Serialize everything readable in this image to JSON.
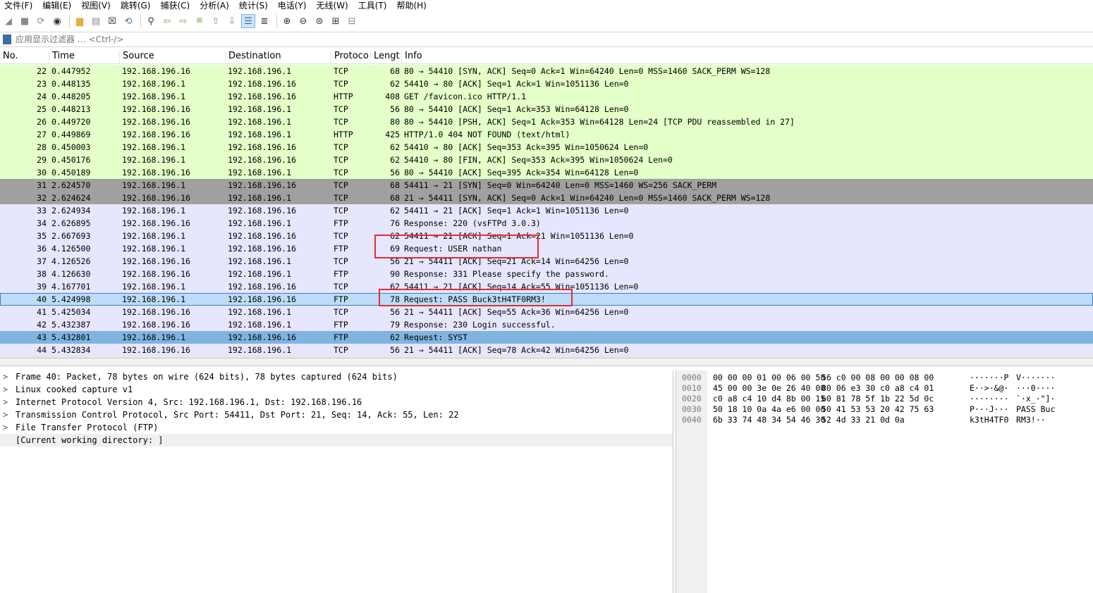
{
  "menubar": {
    "items": [
      "文件(F)",
      "编辑(E)",
      "视图(V)",
      "跳转(G)",
      "捕获(C)",
      "分析(A)",
      "统计(S)",
      "电话(Y)",
      "无线(W)",
      "工具(T)",
      "帮助(H)"
    ]
  },
  "toolbar": {
    "icons": [
      "shark-fin-start-icon",
      "stop-icon",
      "restart-icon",
      "capture-options-icon",
      "open-folder-icon",
      "save-icon",
      "close-file-icon",
      "reload-icon",
      "find-packet-icon",
      "go-back-icon",
      "go-forward-icon",
      "go-to-packet-icon",
      "go-first-icon",
      "go-last-icon",
      "autoscroll-icon",
      "colorize-icon",
      "zoom-in-icon",
      "zoom-out-icon",
      "zoom-normal-icon",
      "resize-columns-icon",
      "layout-icon"
    ]
  },
  "filter": {
    "placeholder": "应用显示过滤器 … <Ctrl-/>"
  },
  "columns": {
    "no": "No.",
    "time": "Time",
    "source": "Source",
    "destination": "Destination",
    "protocol": "Protoco",
    "length": "Lengt",
    "info": "Info"
  },
  "colors": {
    "http_green": "#e4ffc7",
    "syn_gray": "#a0a0a0",
    "tcp_lavender": "#e7e6ff",
    "selected": "#bcdcf7",
    "marked_blue": "#7fb4e0",
    "annotation_red": "#e03030"
  },
  "packets": [
    {
      "no": "22",
      "time": "0.447952",
      "src": "192.168.196.16",
      "dst": "192.168.196.1",
      "proto": "TCP",
      "len": "68",
      "info": "80 → 54410 [SYN, ACK] Seq=0 Ack=1 Win=64240 Len=0 MSS=1460 SACK_PERM WS=128",
      "color": "green"
    },
    {
      "no": "23",
      "time": "0.448135",
      "src": "192.168.196.1",
      "dst": "192.168.196.16",
      "proto": "TCP",
      "len": "62",
      "info": "54410 → 80 [ACK] Seq=1 Ack=1 Win=1051136 Len=0",
      "color": "green"
    },
    {
      "no": "24",
      "time": "0.448205",
      "src": "192.168.196.1",
      "dst": "192.168.196.16",
      "proto": "HTTP",
      "len": "408",
      "info": "GET /favicon.ico HTTP/1.1",
      "color": "green"
    },
    {
      "no": "25",
      "time": "0.448213",
      "src": "192.168.196.16",
      "dst": "192.168.196.1",
      "proto": "TCP",
      "len": "56",
      "info": "80 → 54410 [ACK] Seq=1 Ack=353 Win=64128 Len=0",
      "color": "green"
    },
    {
      "no": "26",
      "time": "0.449720",
      "src": "192.168.196.16",
      "dst": "192.168.196.1",
      "proto": "TCP",
      "len": "80",
      "info": "80 → 54410 [PSH, ACK] Seq=1 Ack=353 Win=64128 Len=24 [TCP PDU reassembled in 27]",
      "color": "green"
    },
    {
      "no": "27",
      "time": "0.449869",
      "src": "192.168.196.16",
      "dst": "192.168.196.1",
      "proto": "HTTP",
      "len": "425",
      "info": "HTTP/1.0 404 NOT FOUND  (text/html)",
      "color": "green"
    },
    {
      "no": "28",
      "time": "0.450003",
      "src": "192.168.196.1",
      "dst": "192.168.196.16",
      "proto": "TCP",
      "len": "62",
      "info": "54410 → 80 [ACK] Seq=353 Ack=395 Win=1050624 Len=0",
      "color": "green"
    },
    {
      "no": "29",
      "time": "0.450176",
      "src": "192.168.196.1",
      "dst": "192.168.196.16",
      "proto": "TCP",
      "len": "62",
      "info": "54410 → 80 [FIN, ACK] Seq=353 Ack=395 Win=1050624 Len=0",
      "color": "green"
    },
    {
      "no": "30",
      "time": "0.450189",
      "src": "192.168.196.16",
      "dst": "192.168.196.1",
      "proto": "TCP",
      "len": "56",
      "info": "80 → 54410 [ACK] Seq=395 Ack=354 Win=64128 Len=0",
      "color": "green"
    },
    {
      "no": "31",
      "time": "2.624570",
      "src": "192.168.196.1",
      "dst": "192.168.196.16",
      "proto": "TCP",
      "len": "68",
      "info": "54411 → 21 [SYN] Seq=0 Win=64240 Len=0 MSS=1460 WS=256 SACK_PERM",
      "color": "gray"
    },
    {
      "no": "32",
      "time": "2.624624",
      "src": "192.168.196.16",
      "dst": "192.168.196.1",
      "proto": "TCP",
      "len": "68",
      "info": "21 → 54411 [SYN, ACK] Seq=0 Ack=1 Win=64240 Len=0 MSS=1460 SACK_PERM WS=128",
      "color": "gray"
    },
    {
      "no": "33",
      "time": "2.624934",
      "src": "192.168.196.1",
      "dst": "192.168.196.16",
      "proto": "TCP",
      "len": "62",
      "info": "54411 → 21 [ACK] Seq=1 Ack=1 Win=1051136 Len=0",
      "color": "lavender"
    },
    {
      "no": "34",
      "time": "2.626895",
      "src": "192.168.196.16",
      "dst": "192.168.196.1",
      "proto": "FTP",
      "len": "76",
      "info": "Response: 220 (vsFTPd 3.0.3)",
      "color": "lavender"
    },
    {
      "no": "35",
      "time": "2.667693",
      "src": "192.168.196.1",
      "dst": "192.168.196.16",
      "proto": "TCP",
      "len": "62",
      "info": "54411 → 21 [ACK] Seq=1 Ack=21 Win=1051136 Len=0",
      "color": "lavender"
    },
    {
      "no": "36",
      "time": "4.126500",
      "src": "192.168.196.1",
      "dst": "192.168.196.16",
      "proto": "FTP",
      "len": "69",
      "info": "Request: USER nathan",
      "color": "lavender"
    },
    {
      "no": "37",
      "time": "4.126526",
      "src": "192.168.196.16",
      "dst": "192.168.196.1",
      "proto": "TCP",
      "len": "56",
      "info": "21 → 54411 [ACK] Seq=21 Ack=14 Win=64256 Len=0",
      "color": "lavender"
    },
    {
      "no": "38",
      "time": "4.126630",
      "src": "192.168.196.16",
      "dst": "192.168.196.1",
      "proto": "FTP",
      "len": "90",
      "info": "Response: 331 Please specify the password.",
      "color": "lavender"
    },
    {
      "no": "39",
      "time": "4.167701",
      "src": "192.168.196.1",
      "dst": "192.168.196.16",
      "proto": "TCP",
      "len": "62",
      "info": "54411 → 21 [ACK] Seq=14 Ack=55 Win=1051136 Len=0",
      "color": "lavender"
    },
    {
      "no": "40",
      "time": "5.424998",
      "src": "192.168.196.1",
      "dst": "192.168.196.16",
      "proto": "FTP",
      "len": "78",
      "info": "Request: PASS Buck3tH4TF0RM3!",
      "color": "selected"
    },
    {
      "no": "41",
      "time": "5.425034",
      "src": "192.168.196.16",
      "dst": "192.168.196.1",
      "proto": "TCP",
      "len": "56",
      "info": "21 → 54411 [ACK] Seq=55 Ack=36 Win=64256 Len=0",
      "color": "lavender"
    },
    {
      "no": "42",
      "time": "5.432387",
      "src": "192.168.196.16",
      "dst": "192.168.196.1",
      "proto": "FTP",
      "len": "79",
      "info": "Response: 230 Login successful.",
      "color": "lavender"
    },
    {
      "no": "43",
      "time": "5.432801",
      "src": "192.168.196.1",
      "dst": "192.168.196.16",
      "proto": "FTP",
      "len": "62",
      "info": "Request: SYST",
      "color": "marked"
    },
    {
      "no": "44",
      "time": "5.432834",
      "src": "192.168.196.16",
      "dst": "192.168.196.1",
      "proto": "TCP",
      "len": "56",
      "info": "21 → 54411 [ACK] Seq=78 Ack=42 Win=64256 Len=0",
      "color": "lavender"
    }
  ],
  "details": [
    {
      "arrow": ">",
      "text": "Frame 40: Packet, 78 bytes on wire (624 bits), 78 bytes captured (624 bits)"
    },
    {
      "arrow": ">",
      "text": "Linux cooked capture v1"
    },
    {
      "arrow": ">",
      "text": "Internet Protocol Version 4, Src: 192.168.196.1, Dst: 192.168.196.16"
    },
    {
      "arrow": ">",
      "text": "Transmission Control Protocol, Src Port: 54411, Dst Port: 21, Seq: 14, Ack: 55, Len: 22"
    },
    {
      "arrow": ">",
      "text": "File Transfer Protocol (FTP)"
    },
    {
      "arrow": "",
      "text": "[Current working directory: ]"
    }
  ],
  "hex": [
    {
      "off": "0000",
      "h1": "00 00 00 01 00 06 00 50",
      "h2": "56 c0 00 08 00 00 08 00",
      "a1": "·······P",
      "a2": "V·······"
    },
    {
      "off": "0010",
      "h1": "45 00 00 3e 0e 26 40 00",
      "h2": "80 06 e3 30 c0 a8 c4 01",
      "a1": "E··>·&@·",
      "a2": "···0····"
    },
    {
      "off": "0020",
      "h1": "c0 a8 c4 10 d4 8b 00 15",
      "h2": "60 81 78 5f 1b 22 5d 0c",
      "a1": "········",
      "a2": "`·x_·\"]·"
    },
    {
      "off": "0030",
      "h1": "50 18 10 0a 4a e6 00 00",
      "h2": "50 41 53 53 20 42 75 63",
      "a1": "P···J···",
      "a2": "PASS Buc"
    },
    {
      "off": "0040",
      "h1": "6b 33 74 48 34 54 46 30",
      "h2": "52 4d 33 21 0d 0a",
      "a1": "k3tH4TF0",
      "a2": "RM3!··"
    }
  ]
}
